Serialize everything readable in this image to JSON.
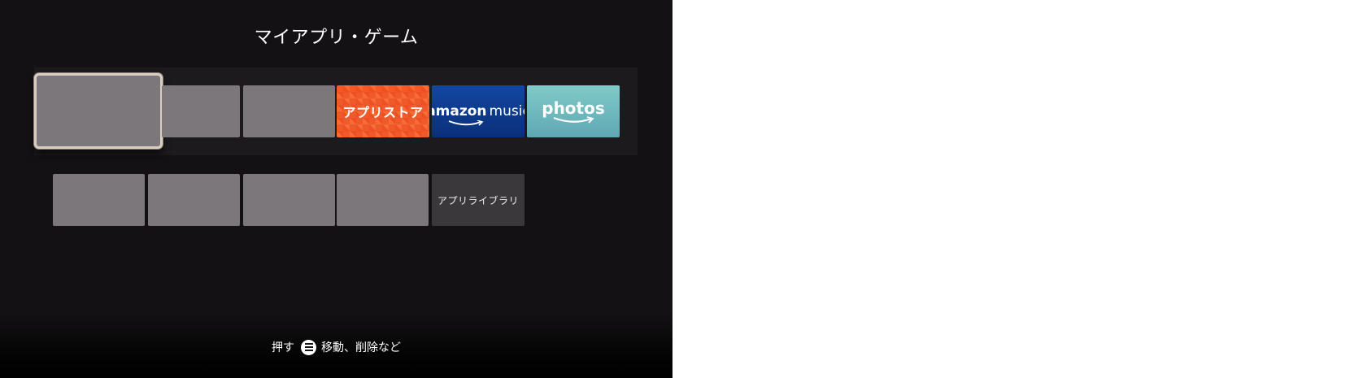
{
  "screen": {
    "title": "マイアプリ・ゲーム"
  },
  "row1": {
    "app_store_label": "アプリストア",
    "music_brand": "amazon",
    "music_label": "music",
    "photos_label": "photos"
  },
  "row2": {
    "library_label": "アプリライブラリ"
  },
  "hint": {
    "press_label": "押す",
    "action_label": "移動、削除など",
    "icon": "menu-icon"
  },
  "colors": {
    "background": "#141114",
    "placeholder_tile": "#7b777b",
    "focus_border": "#d8cdbf",
    "app_store": "#f05a2a",
    "amazon_music": "#1247a0",
    "photos": "#80cac9",
    "library_tile": "#3b383b"
  }
}
